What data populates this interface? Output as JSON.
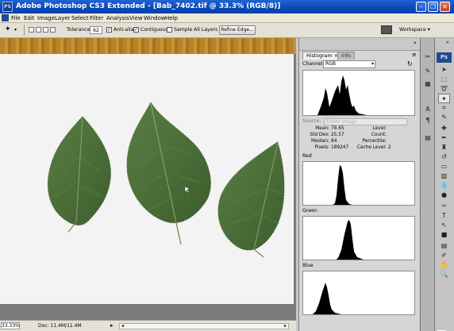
{
  "titlebar": {
    "app_icon": "PS",
    "title": "Adobe Photoshop CS3 Extended - [Bab_7402.tif @ 33.3% (RGB/8)]",
    "window_buttons": [
      "minimize-icon",
      "restore-icon",
      "close-icon"
    ]
  },
  "menubar": {
    "items": [
      "File",
      "Edit",
      "Image",
      "Layer",
      "Select",
      "Filter",
      "Analysis",
      "View",
      "Window",
      "Help"
    ]
  },
  "options": {
    "tolerance_label": "Tolerance:",
    "tolerance_value": "62",
    "anti_alias": "Anti-alias",
    "anti_alias_checked": true,
    "contiguous": "Contiguous",
    "contiguous_checked": true,
    "sample_all": "Sample All Layers",
    "sample_all_checked": false,
    "refine_edge": "Refine Edge...",
    "workspace": "Workspace ▾"
  },
  "status": {
    "zoom": "33.33%",
    "doc": "Doc: 11.4M/11.4M"
  },
  "histogram_panel": {
    "tabs": [
      "Histogram",
      "Info"
    ],
    "channel_label": "Channel:",
    "channel_value": "RGB",
    "source_label": "Source:",
    "source_value": "Entire Image",
    "stats_left": [
      {
        "label": "Mean:",
        "value": "78.65"
      },
      {
        "label": "Std Dev:",
        "value": "25.57"
      },
      {
        "label": "Median:",
        "value": "84"
      },
      {
        "label": "Pixels:",
        "value": "189247"
      }
    ],
    "stats_right": [
      {
        "label": "Level:",
        "value": ""
      },
      {
        "label": "Count:",
        "value": ""
      },
      {
        "label": "Percentile:",
        "value": ""
      },
      {
        "label": "Cache Level:",
        "value": "2"
      }
    ],
    "channels": [
      "Red",
      "Green",
      "Blue"
    ]
  },
  "tools": {
    "logo": "Ps"
  },
  "colors": {
    "titlebar": "#0a48b8",
    "leaf_green": "#4a6d37",
    "histogram_fill": "#000000"
  }
}
